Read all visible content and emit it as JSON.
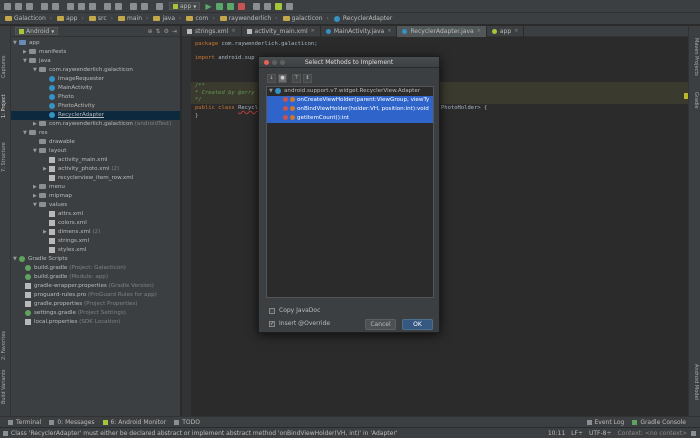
{
  "toolbar": {
    "run_config": "app"
  },
  "breadcrumbs": [
    "Galacticon",
    "app",
    "src",
    "main",
    "java",
    "com",
    "raywenderlich",
    "galacticon",
    "RecyclerAdapter"
  ],
  "left_stripe": {
    "tab_1": "1: Project",
    "tab_2": "Captures",
    "tab_3": "7: Structure",
    "tab_4": "2: Favorites",
    "tab_5": "Build Variants"
  },
  "right_stripe": {
    "tab_1": "Maven Projects",
    "tab_2": "Gradle",
    "tab_3": "Android Model"
  },
  "project_panel": {
    "view_mode": "Android",
    "tree": [
      {
        "label": "app",
        "extra": ""
      },
      {
        "label": "manifests",
        "extra": ""
      },
      {
        "label": "java",
        "extra": ""
      },
      {
        "label": "com.raywenderlich.galacticon",
        "extra": ""
      },
      {
        "label": "ImageRequester",
        "extra": ""
      },
      {
        "label": "MainActivity",
        "extra": ""
      },
      {
        "label": "Photo",
        "extra": ""
      },
      {
        "label": "PhotoActivity",
        "extra": ""
      },
      {
        "label": "RecyclerAdapter",
        "extra": ""
      },
      {
        "label": "com.raywenderlich.galacticon",
        "extra": "(androidTest)"
      },
      {
        "label": "res",
        "extra": ""
      },
      {
        "label": "drawable",
        "extra": ""
      },
      {
        "label": "layout",
        "extra": ""
      },
      {
        "label": "activity_main.xml",
        "extra": ""
      },
      {
        "label": "activity_photo.xml",
        "extra": "(2)"
      },
      {
        "label": "recyclerview_item_row.xml",
        "extra": ""
      },
      {
        "label": "menu",
        "extra": ""
      },
      {
        "label": "mipmap",
        "extra": ""
      },
      {
        "label": "values",
        "extra": ""
      },
      {
        "label": "attrs.xml",
        "extra": ""
      },
      {
        "label": "colors.xml",
        "extra": ""
      },
      {
        "label": "dimens.xml",
        "extra": "(2)"
      },
      {
        "label": "strings.xml",
        "extra": ""
      },
      {
        "label": "styles.xml",
        "extra": ""
      },
      {
        "label": "Gradle Scripts",
        "extra": ""
      },
      {
        "label": "build.gradle",
        "extra": "(Project: Galacticon)"
      },
      {
        "label": "build.gradle",
        "extra": "(Module: app)"
      },
      {
        "label": "gradle-wrapper.properties",
        "extra": "(Gradle Version)"
      },
      {
        "label": "proguard-rules.pro",
        "extra": "(ProGuard Rules for app)"
      },
      {
        "label": "gradle.properties",
        "extra": "(Project Properties)"
      },
      {
        "label": "settings.gradle",
        "extra": "(Project Settings)"
      },
      {
        "label": "local.properties",
        "extra": "(SDK Location)"
      }
    ]
  },
  "editor_tabs": [
    {
      "label": "strings.xml"
    },
    {
      "label": "activity_main.xml"
    },
    {
      "label": "MainActivity.java"
    },
    {
      "label": "RecyclerAdapter.java"
    },
    {
      "label": "app"
    }
  ],
  "editor": {
    "line_package_kw": "package",
    "line_package": "com.raywenderlich.galacticon;",
    "line_import_kw": "import",
    "line_import": "android.sup",
    "comment_1": "/**",
    "comment_2": " * Created by @orry",
    "comment_3": " */",
    "class_line_kw": "public class",
    "class_line": "Recycl",
    "class_line_tail": "PhotoHolder>  {",
    "close_brace": "}"
  },
  "dialog": {
    "title": "Select Methods to Implement",
    "root_class": "android.support.v7.widget.RecyclerView.Adapter",
    "methods": [
      {
        "label": "onCreateViewHolder(parent:ViewGroup, viewTy"
      },
      {
        "label": "onBindViewHolder(holder:VH, position:int):void"
      },
      {
        "label": "getItemCount():int"
      }
    ],
    "copy_javadoc_label": "Copy JavaDoc",
    "copy_javadoc_checked": false,
    "insert_override_label": "Insert @Override",
    "insert_override_checked": true,
    "cancel_label": "Cancel",
    "ok_label": "OK"
  },
  "bottom_tabs": {
    "terminal": "Terminal",
    "messages": "0: Messages",
    "android_monitor": "6: Android Monitor",
    "todo": "TODO",
    "event_log": "Event Log",
    "gradle_console": "Gradle Console"
  },
  "status_bar": {
    "message": "Class 'RecyclerAdapter' must either be declared abstract or implement abstract method 'onBindViewHolder(VH, int)' in 'Adapter'",
    "position": "10:11",
    "line_sep": "LF÷",
    "encoding": "UTF-8÷",
    "context": "Context: <no context>"
  }
}
